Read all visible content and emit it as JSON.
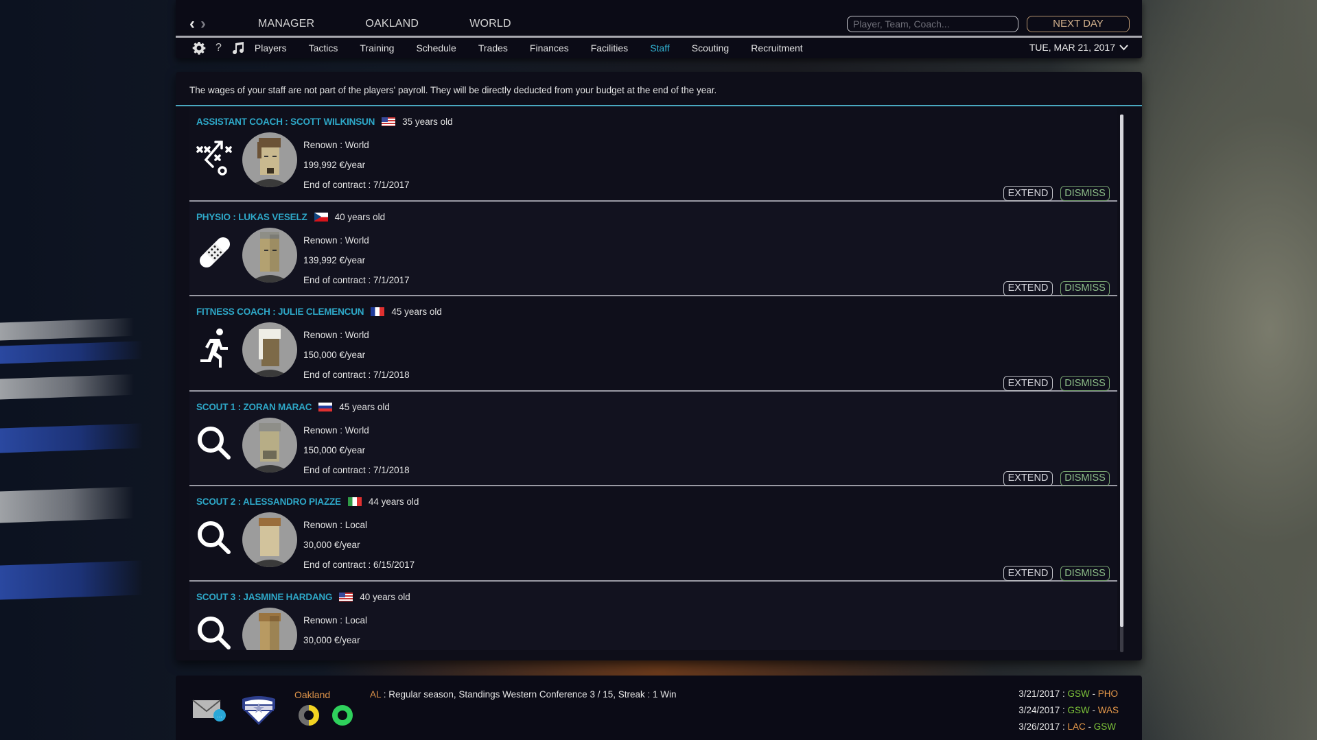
{
  "topbar": {
    "back_icon": "chevron-left-icon",
    "forward_icon": "chevron-right-icon",
    "main_nav": [
      "MANAGER",
      "OAKLAND",
      "WORLD"
    ],
    "search_placeholder": "Player, Team, Coach...",
    "next_day_label": "NEXT DAY",
    "sub_nav_icons": [
      "gear-icon",
      "help-icon",
      "music-icon"
    ],
    "help_glyph": "?",
    "tabs": [
      "Players",
      "Tactics",
      "Training",
      "Schedule",
      "Trades",
      "Finances",
      "Facilities",
      "Staff",
      "Scouting",
      "Recruitment"
    ],
    "active_tab": "Staff",
    "date": "TUE, MAR 21, 2017"
  },
  "panel": {
    "notice": "The wages of your staff are not part of the players' payroll. They will be directly deducted from your budget at the end of the year.",
    "extend_label": "EXTEND",
    "dismiss_label": "DISMISS",
    "staff": [
      {
        "title": "ASSISTANT COACH : SCOTT WILKINSUN",
        "flag": "USA",
        "age": "35 years old",
        "renown": "Renown : World",
        "wage": "199,992 €/year",
        "contract": "End of contract : 7/1/2017",
        "icon": "tactics-play-icon"
      },
      {
        "title": "PHYSIO : LUKAS VESELZ",
        "flag": "Czech Republic",
        "age": "40 years old",
        "renown": "Renown : World",
        "wage": "139,992 €/year",
        "contract": "End of contract : 7/1/2017",
        "icon": "bandage-icon"
      },
      {
        "title": "FITNESS COACH : JULIE CLEMENCUN",
        "flag": "France",
        "age": "45 years old",
        "renown": "Renown : World",
        "wage": "150,000 €/year",
        "contract": "End of contract : 7/1/2018",
        "icon": "running-man-icon"
      },
      {
        "title": "SCOUT 1 : ZORAN MARAC",
        "flag": "Slovenia",
        "age": "45 years old",
        "renown": "Renown : World",
        "wage": "150,000 €/year",
        "contract": "End of contract : 7/1/2018",
        "icon": "magnifier-icon"
      },
      {
        "title": "SCOUT 2 : ALESSANDRO PIAZZE",
        "flag": "Italy",
        "age": "44 years old",
        "renown": "Renown : Local",
        "wage": "30,000 €/year",
        "contract": "End of contract : 6/15/2017",
        "icon": "magnifier-icon"
      },
      {
        "title": "SCOUT 3 : JASMINE HARDANG",
        "flag": "USA",
        "age": "40 years old",
        "renown": "Renown : Local",
        "wage": "30,000 €/year",
        "contract": "",
        "icon": "magnifier-icon"
      }
    ]
  },
  "footer": {
    "team_name": "Oakland",
    "league": "AL",
    "status_text": " : Regular season, Standings Western Conference 3 / 15, Streak : 1 Win",
    "upcoming_games": [
      {
        "date": "3/21/2017 : ",
        "home": "GSW",
        "away": "PHO",
        "home_color": "#7fc63a",
        "away_color": "#e89a4a"
      },
      {
        "date": "3/24/2017 : ",
        "home": "GSW",
        "away": "WAS",
        "home_color": "#7fc63a",
        "away_color": "#e89a4a"
      },
      {
        "date": "3/26/2017 : ",
        "home": "LAC",
        "away": "GSW",
        "home_color": "#e89a4a",
        "away_color": "#7fc63a"
      }
    ]
  },
  "colors": {
    "accent": "#33b6d6",
    "role_title": "#2ea8c8",
    "next_day": "#d2b18d",
    "dismiss": "#8fc08a",
    "team": "#e0954a"
  }
}
